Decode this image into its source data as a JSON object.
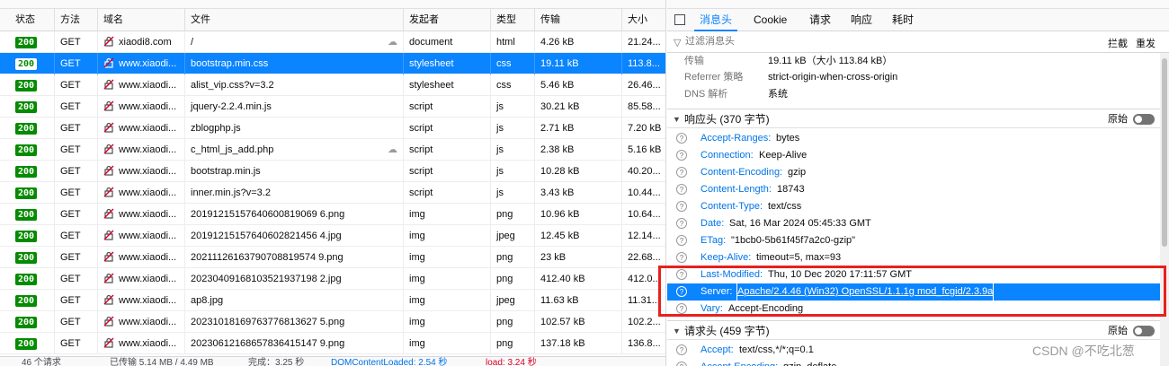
{
  "request_table": {
    "columns": [
      "状态",
      "方法",
      "域名",
      "文件",
      "发起者",
      "类型",
      "传输",
      "大小"
    ],
    "rows": [
      {
        "status": "200",
        "method": "GET",
        "domain": "xiaodi8.com",
        "file": "/",
        "initiator": "document",
        "type": "html",
        "transferred": "4.26 kB",
        "size": "21.24...",
        "tracker": true,
        "selected": false
      },
      {
        "status": "200",
        "method": "GET",
        "domain": "www.xiaodi...",
        "file": "bootstrap.min.css",
        "initiator": "stylesheet",
        "type": "css",
        "transferred": "19.11 kB",
        "size": "113.8...",
        "tracker": false,
        "selected": true
      },
      {
        "status": "200",
        "method": "GET",
        "domain": "www.xiaodi...",
        "file": "alist_vip.css?v=3.2",
        "initiator": "stylesheet",
        "type": "css",
        "transferred": "5.46 kB",
        "size": "26.46...",
        "tracker": false,
        "selected": false
      },
      {
        "status": "200",
        "method": "GET",
        "domain": "www.xiaodi...",
        "file": "jquery-2.2.4.min.js",
        "initiator": "script",
        "type": "js",
        "transferred": "30.21 kB",
        "size": "85.58...",
        "tracker": false,
        "selected": false
      },
      {
        "status": "200",
        "method": "GET",
        "domain": "www.xiaodi...",
        "file": "zblogphp.js",
        "initiator": "script",
        "type": "js",
        "transferred": "2.71 kB",
        "size": "7.20 kB",
        "tracker": false,
        "selected": false
      },
      {
        "status": "200",
        "method": "GET",
        "domain": "www.xiaodi...",
        "file": "c_html_js_add.php",
        "initiator": "script",
        "type": "js",
        "transferred": "2.38 kB",
        "size": "5.16 kB",
        "tracker": true,
        "selected": false
      },
      {
        "status": "200",
        "method": "GET",
        "domain": "www.xiaodi...",
        "file": "bootstrap.min.js",
        "initiator": "script",
        "type": "js",
        "transferred": "10.28 kB",
        "size": "40.20...",
        "tracker": false,
        "selected": false
      },
      {
        "status": "200",
        "method": "GET",
        "domain": "www.xiaodi...",
        "file": "inner.min.js?v=3.2",
        "initiator": "script",
        "type": "js",
        "transferred": "3.43 kB",
        "size": "10.44...",
        "tracker": false,
        "selected": false
      },
      {
        "status": "200",
        "method": "GET",
        "domain": "www.xiaodi...",
        "file": "20191215157640600819069 6.png",
        "initiator": "img",
        "type": "png",
        "transferred": "10.96 kB",
        "size": "10.64...",
        "tracker": false,
        "selected": false
      },
      {
        "status": "200",
        "method": "GET",
        "domain": "www.xiaodi...",
        "file": "20191215157640602821456 4.jpg",
        "initiator": "img",
        "type": "jpeg",
        "transferred": "12.45 kB",
        "size": "12.14...",
        "tracker": false,
        "selected": false
      },
      {
        "status": "200",
        "method": "GET",
        "domain": "www.xiaodi...",
        "file": "20211126163790708819574 9.png",
        "initiator": "img",
        "type": "png",
        "transferred": "23 kB",
        "size": "22.68...",
        "tracker": false,
        "selected": false
      },
      {
        "status": "200",
        "method": "GET",
        "domain": "www.xiaodi...",
        "file": "20230409168103521937198 2.jpg",
        "initiator": "img",
        "type": "png",
        "transferred": "412.40 kB",
        "size": "412.0...",
        "tracker": false,
        "selected": false
      },
      {
        "status": "200",
        "method": "GET",
        "domain": "www.xiaodi...",
        "file": "ap8.jpg",
        "initiator": "img",
        "type": "jpeg",
        "transferred": "11.63 kB",
        "size": "11.31...",
        "tracker": false,
        "selected": false
      },
      {
        "status": "200",
        "method": "GET",
        "domain": "www.xiaodi...",
        "file": "20231018169763776813627 5.png",
        "initiator": "img",
        "type": "png",
        "transferred": "102.57 kB",
        "size": "102.2...",
        "tracker": false,
        "selected": false
      },
      {
        "status": "200",
        "method": "GET",
        "domain": "www.xiaodi...",
        "file": "20230612168657836415147 9.png",
        "initiator": "img",
        "type": "png",
        "transferred": "137.18 kB",
        "size": "136.8...",
        "tracker": false,
        "selected": false
      }
    ]
  },
  "status_bar": {
    "requests": "46 个请求",
    "transferred": "已传输 5.14 MB / 4.49 MB",
    "finish": "完成：3.25 秒",
    "domcontentloaded": "DOMContentLoaded: 2.54 秒",
    "load": "load: 3.24 秒"
  },
  "detail_tabs": [
    "消息头",
    "Cookie",
    "请求",
    "响应",
    "耗时"
  ],
  "filter": {
    "placeholder": "过滤消息头",
    "block_label": "拦截",
    "resend_label": "重发"
  },
  "summary": [
    {
      "label": "传输",
      "value": "19.11 kB（大小 113.84 kB）"
    },
    {
      "label": "Referrer 策略",
      "value": "strict-origin-when-cross-origin"
    },
    {
      "label": "DNS 解析",
      "value": "系统"
    }
  ],
  "response_section": {
    "title": "响应头 (370 字节)",
    "raw_label": "原始"
  },
  "response_headers": [
    {
      "name": "Accept-Ranges:",
      "value": "bytes"
    },
    {
      "name": "Connection:",
      "value": "Keep-Alive"
    },
    {
      "name": "Content-Encoding:",
      "value": "gzip"
    },
    {
      "name": "Content-Length:",
      "value": "18743"
    },
    {
      "name": "Content-Type:",
      "value": "text/css"
    },
    {
      "name": "Date:",
      "value": "Sat, 16 Mar 2024 05:45:33 GMT"
    },
    {
      "name": "ETag:",
      "value": "\"1bcb0-5b61f45f7a2c0-gzip\""
    },
    {
      "name": "Keep-Alive:",
      "value": "timeout=5, max=93"
    },
    {
      "name": "Last-Modified:",
      "value": "Thu, 10 Dec 2020 17:11:57 GMT"
    },
    {
      "name": "Server:",
      "value": "Apache/2.4.46 (Win32) OpenSSL/1.1.1g mod_fcgid/2.3.9a"
    },
    {
      "name": "Vary:",
      "value": "Accept-Encoding"
    }
  ],
  "request_section": {
    "title": "请求头 (459 字节)",
    "raw_label": "原始"
  },
  "request_headers": [
    {
      "name": "Accept:",
      "value": "text/css,*/*;q=0.1"
    },
    {
      "name": "Accept-Encoding:",
      "value": "gzip, deflate"
    }
  ],
  "watermark": "CSDN @不吃北葱",
  "colors": {
    "selected": "#0a84ff",
    "status_ok": "#058b00",
    "highlight_box": "#e8201c",
    "header_name": "#0074e8"
  }
}
